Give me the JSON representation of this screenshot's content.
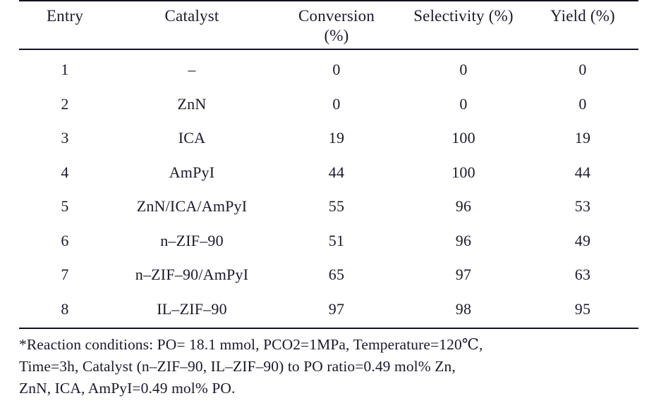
{
  "table": {
    "columns": [
      {
        "id": "entry",
        "label": "Entry"
      },
      {
        "id": "catalyst",
        "label": "Catalyst"
      },
      {
        "id": "conversion",
        "label": "Conversion (%)"
      },
      {
        "id": "selectivity",
        "label": "Selectivity (%)"
      },
      {
        "id": "yield",
        "label": "Yield (%)"
      }
    ],
    "column_labels_wrapped": {
      "conversion_line1": "Conversion",
      "conversion_line2": "(%)"
    },
    "rows": [
      {
        "entry": "1",
        "catalyst": "–",
        "conversion": "0",
        "selectivity": "0",
        "yield": "0"
      },
      {
        "entry": "2",
        "catalyst": "ZnN",
        "conversion": "0",
        "selectivity": "0",
        "yield": "0"
      },
      {
        "entry": "3",
        "catalyst": "ICA",
        "conversion": "19",
        "selectivity": "100",
        "yield": "19"
      },
      {
        "entry": "4",
        "catalyst": "AmPyI",
        "conversion": "44",
        "selectivity": "100",
        "yield": "44"
      },
      {
        "entry": "5",
        "catalyst": "ZnN/ICA/AmPyI",
        "conversion": "55",
        "selectivity": "96",
        "yield": "53"
      },
      {
        "entry": "6",
        "catalyst": "n–ZIF–90",
        "conversion": "51",
        "selectivity": "96",
        "yield": "49"
      },
      {
        "entry": "7",
        "catalyst": "n–ZIF–90/AmPyI",
        "conversion": "65",
        "selectivity": "97",
        "yield": "63"
      },
      {
        "entry": "8",
        "catalyst": "IL–ZIF–90",
        "conversion": "97",
        "selectivity": "98",
        "yield": "95"
      }
    ]
  },
  "footnote": {
    "line1": "*Reaction conditions: PO= 18.1 mmol, PCO2=1MPa, Temperature=120℃,",
    "line2": "Time=3h, Catalyst (n–ZIF–90, IL–ZIF–90) to PO ratio=0.49 mol% Zn,",
    "line3": "ZnN, ICA, AmPyI=0.49 mol% PO."
  },
  "style": {
    "rule_color": "#111122",
    "text_color": "#1a1a2e",
    "background": "#ffffff"
  }
}
